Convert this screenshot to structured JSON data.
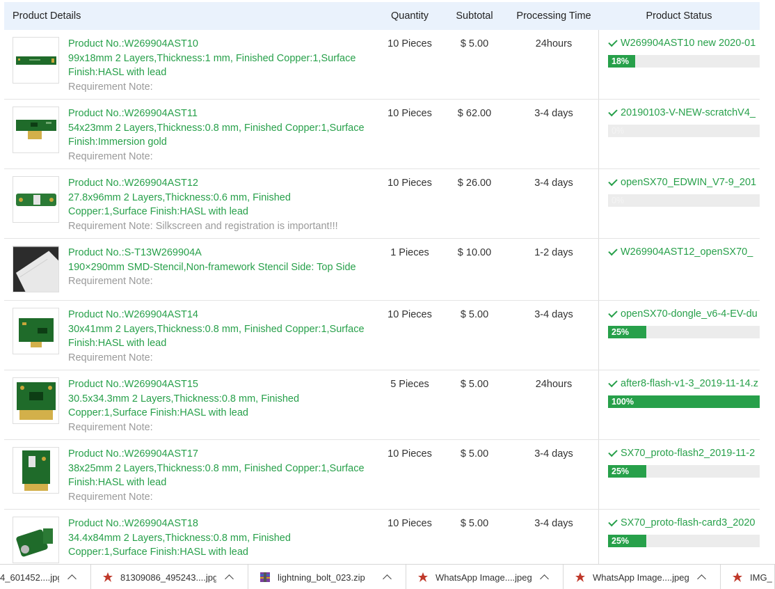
{
  "table": {
    "headers": {
      "details": "Product Details",
      "quantity": "Quantity",
      "subtotal": "Subtotal",
      "processing": "Processing Time",
      "status": "Product Status"
    },
    "rows": [
      {
        "product_no": "Product No.:W269904AST10",
        "spec_line1": "99x18mm 2 Layers,Thickness:1 mm, Finished Copper:1,Surface",
        "spec_line2": "Finish:HASL with lead",
        "note": "Requirement Note:",
        "quantity": "10 Pieces",
        "subtotal": "$ 5.00",
        "processing": "24hours",
        "file": "W269904AST10 new 2020-01",
        "progress_label": "18%",
        "progress": 18
      },
      {
        "product_no": "Product No.:W269904AST11",
        "spec_line1": "54x23mm 2 Layers,Thickness:0.8 mm, Finished Copper:1,Surface",
        "spec_line2": "Finish:Immersion gold",
        "note": "Requirement Note:",
        "quantity": "10 Pieces",
        "subtotal": "$ 62.00",
        "processing": "3-4 days",
        "file": "20190103-V-NEW-scratchV4_",
        "progress_label": "0%",
        "progress": 0
      },
      {
        "product_no": "Product No.:W269904AST12",
        "spec_line1": "27.8x96mm 2 Layers,Thickness:0.6 mm, Finished",
        "spec_line2": "Copper:1,Surface Finish:HASL with lead",
        "note": "Requirement Note: Silkscreen and registration is important!!!",
        "quantity": "10 Pieces",
        "subtotal": "$ 26.00",
        "processing": "3-4 days",
        "file": "openSX70_EDWIN_V7-9_201",
        "progress_label": "0%",
        "progress": 0
      },
      {
        "product_no": "Product No.:S-T13W269904A",
        "spec_line1": "190×290mm SMD-Stencil,Non-framework Stencil Side: Top Side",
        "spec_line2": "",
        "note": "Requirement Note:",
        "quantity": "1 Pieces",
        "subtotal": "$ 10.00",
        "processing": "1-2 days",
        "file": "W269904AST12_openSX70_",
        "progress_label": "",
        "progress": null
      },
      {
        "product_no": "Product No.:W269904AST14",
        "spec_line1": "30x41mm 2 Layers,Thickness:0.8 mm, Finished Copper:1,Surface",
        "spec_line2": "Finish:HASL with lead",
        "note": "Requirement Note:",
        "quantity": "10 Pieces",
        "subtotal": "$ 5.00",
        "processing": "3-4 days",
        "file": "openSX70-dongle_v6-4-EV-du",
        "progress_label": "25%",
        "progress": 25
      },
      {
        "product_no": "Product No.:W269904AST15",
        "spec_line1": "30.5x34.3mm 2 Layers,Thickness:0.8 mm, Finished",
        "spec_line2": "Copper:1,Surface Finish:HASL with lead",
        "note": "Requirement Note:",
        "quantity": "5 Pieces",
        "subtotal": "$ 5.00",
        "processing": "24hours",
        "file": "after8-flash-v1-3_2019-11-14.z",
        "progress_label": "100%",
        "progress": 100
      },
      {
        "product_no": "Product No.:W269904AST17",
        "spec_line1": "38x25mm 2 Layers,Thickness:0.8 mm, Finished Copper:1,Surface",
        "spec_line2": "Finish:HASL with lead",
        "note": "Requirement Note:",
        "quantity": "10 Pieces",
        "subtotal": "$ 5.00",
        "processing": "3-4 days",
        "file": "SX70_proto-flash2_2019-11-2",
        "progress_label": "25%",
        "progress": 25
      },
      {
        "product_no": "Product No.:W269904AST18",
        "spec_line1": "34.4x84mm 2 Layers,Thickness:0.8 mm, Finished",
        "spec_line2": "Copper:1,Surface Finish:HASL with lead",
        "note": "",
        "quantity": "10 Pieces",
        "subtotal": "$ 5.00",
        "processing": "3-4 days",
        "file": "SX70_proto-flash-card3_2020",
        "progress_label": "25%",
        "progress": 25
      }
    ]
  },
  "colors": {
    "accent_green": "#27a04a",
    "header_bg": "#eaf2fc",
    "progress_track": "#ececec"
  },
  "downloads": [
    {
      "name": "4_601452....jpg",
      "icon": "image-file-icon"
    },
    {
      "name": "81309086_495243....jpg",
      "icon": "image-file-icon"
    },
    {
      "name": "lightning_bolt_023.zip",
      "icon": "archive-file-icon"
    },
    {
      "name": "WhatsApp Image....jpeg",
      "icon": "image-file-icon"
    },
    {
      "name": "WhatsApp Image....jpeg",
      "icon": "image-file-icon"
    },
    {
      "name": "IMG_",
      "icon": "image-file-icon"
    }
  ]
}
